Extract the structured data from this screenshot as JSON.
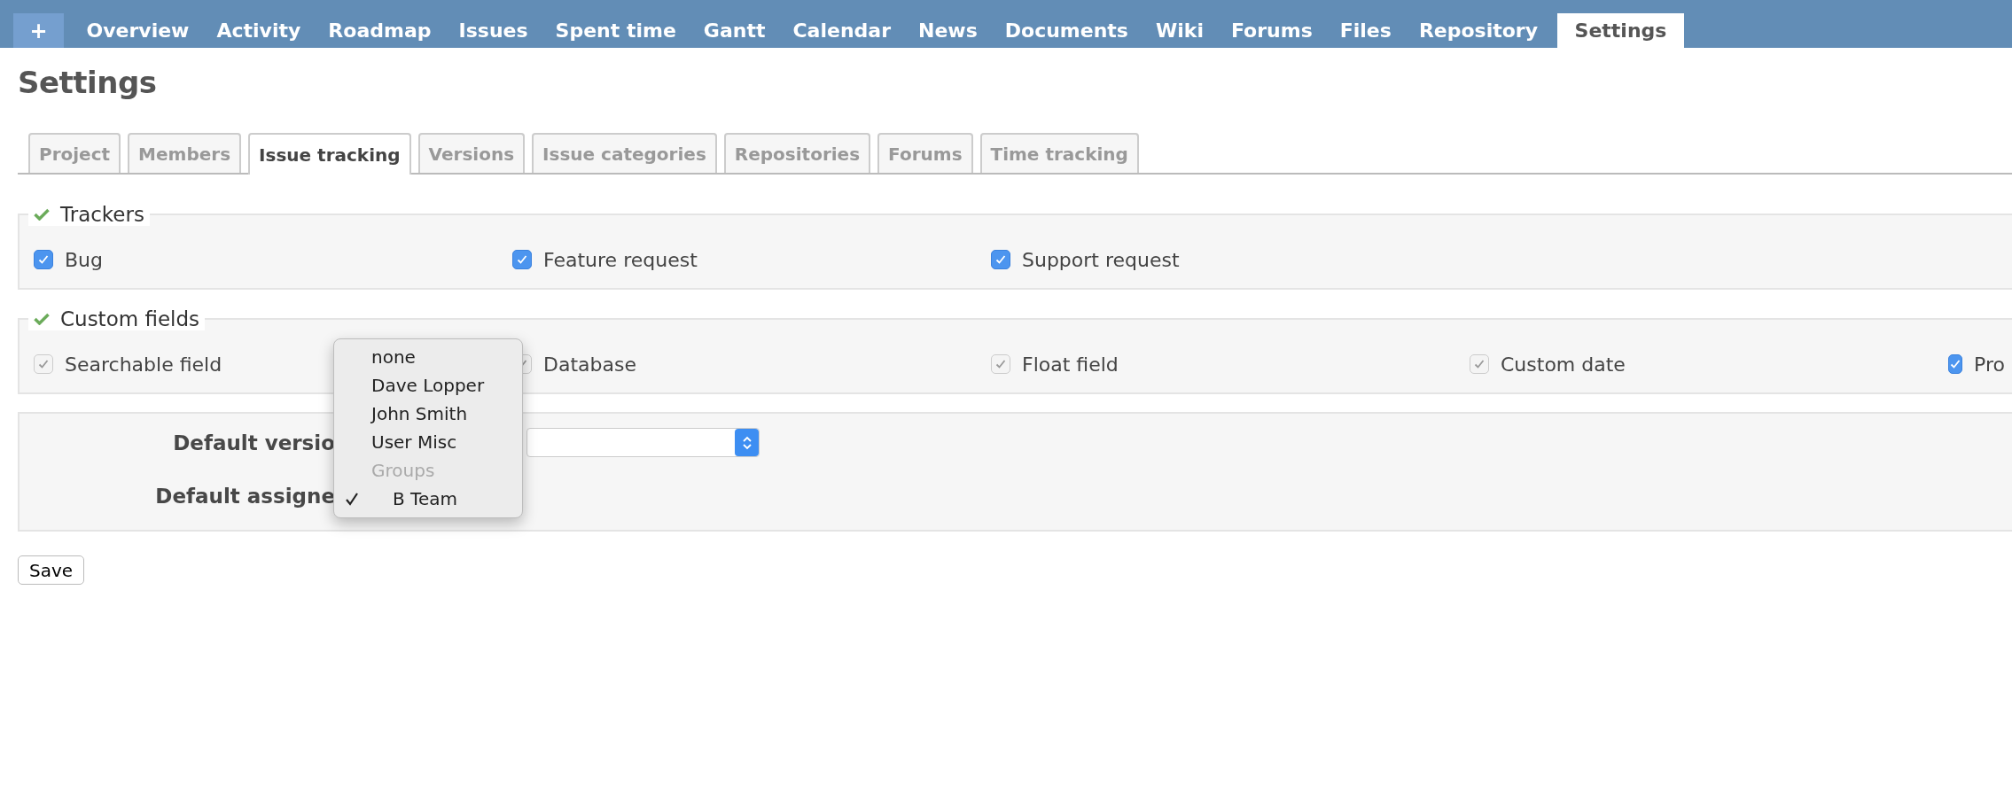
{
  "top_menu": {
    "new_button": "+",
    "items": [
      {
        "label": "Overview",
        "selected": false
      },
      {
        "label": "Activity",
        "selected": false
      },
      {
        "label": "Roadmap",
        "selected": false
      },
      {
        "label": "Issues",
        "selected": false
      },
      {
        "label": "Spent time",
        "selected": false
      },
      {
        "label": "Gantt",
        "selected": false
      },
      {
        "label": "Calendar",
        "selected": false
      },
      {
        "label": "News",
        "selected": false
      },
      {
        "label": "Documents",
        "selected": false
      },
      {
        "label": "Wiki",
        "selected": false
      },
      {
        "label": "Forums",
        "selected": false
      },
      {
        "label": "Files",
        "selected": false
      },
      {
        "label": "Repository",
        "selected": false
      },
      {
        "label": "Settings",
        "selected": true
      }
    ]
  },
  "page_title": "Settings",
  "tabs": [
    {
      "label": "Project",
      "selected": false
    },
    {
      "label": "Members",
      "selected": false
    },
    {
      "label": "Issue tracking",
      "selected": true
    },
    {
      "label": "Versions",
      "selected": false
    },
    {
      "label": "Issue categories",
      "selected": false
    },
    {
      "label": "Repositories",
      "selected": false
    },
    {
      "label": "Forums",
      "selected": false
    },
    {
      "label": "Time tracking",
      "selected": false
    }
  ],
  "sections": [
    {
      "title": "Trackers",
      "items": [
        {
          "label": "Bug",
          "checked": true,
          "disabled": false
        },
        {
          "label": "Feature request",
          "checked": true,
          "disabled": false
        },
        {
          "label": "Support request",
          "checked": true,
          "disabled": false
        }
      ]
    },
    {
      "title": "Custom fields",
      "items": [
        {
          "label": "Searchable field",
          "checked": true,
          "disabled": true
        },
        {
          "label": "Database",
          "checked": true,
          "disabled": true
        },
        {
          "label": "Float field",
          "checked": true,
          "disabled": true
        },
        {
          "label": "Custom date",
          "checked": true,
          "disabled": true
        },
        {
          "label": "Pro",
          "checked": true,
          "disabled": false
        }
      ]
    }
  ],
  "defaults": {
    "rows": [
      {
        "label": "Default versio",
        "has_select": true
      },
      {
        "label": "Default assigne",
        "has_select": false
      }
    ]
  },
  "dropdown": {
    "items": [
      {
        "label": "none",
        "kind": "option",
        "selected": false
      },
      {
        "label": "Dave Lopper",
        "kind": "option",
        "selected": false
      },
      {
        "label": "John Smith",
        "kind": "option",
        "selected": false
      },
      {
        "label": "User Misc",
        "kind": "option",
        "selected": false
      },
      {
        "label": "Groups",
        "kind": "group"
      },
      {
        "label": "B Team",
        "kind": "option",
        "selected": true
      }
    ]
  },
  "save_button": "Save"
}
